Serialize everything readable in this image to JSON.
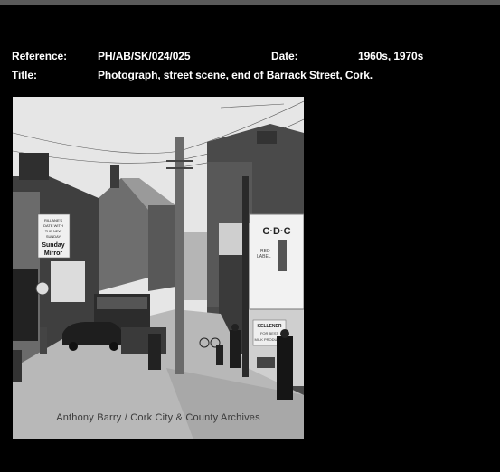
{
  "record": {
    "reference_label": "Reference:",
    "reference_value": "PH/AB/SK/024/025",
    "date_label": "Date:",
    "date_value": "1960s, 1970s",
    "title_label": "Title:",
    "title_value": "Photograph, street scene, end of Barrack Street, Cork."
  },
  "photo": {
    "credit": "Anthony Barry /  Cork City & County Archives",
    "signs": {
      "reilly_1": "RILLANE'S",
      "reilly_2": "DATE WITH",
      "reilly_3": "THE NEW",
      "reilly_4": "SUNDAY",
      "reilly_5": "Sunday",
      "reilly_6": "Mirror",
      "cdc": "C·D·C",
      "red": "RED",
      "label": "LABEL",
      "kellener_1": "KELLENER",
      "kellener_2": "FOR BEST",
      "kellener_3": "MILK PRODUCTS"
    }
  }
}
